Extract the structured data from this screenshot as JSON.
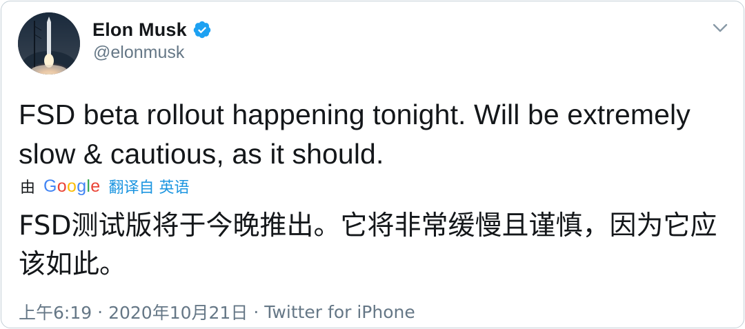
{
  "author": {
    "display_name": "Elon Musk",
    "handle": "@elonmusk",
    "verified": true
  },
  "tweet": {
    "text": "FSD beta rollout happening tonight. Will be extremely slow & cautious, as it should."
  },
  "translation": {
    "prefix": "由",
    "provider_letters": [
      "G",
      "o",
      "o",
      "g",
      "l",
      "e"
    ],
    "provider_colors": [
      "#4285f4",
      "#ea4335",
      "#fbbc05",
      "#4285f4",
      "#34a853",
      "#ea4335"
    ],
    "link_text": "翻译自 英语",
    "text": "FSD测试版将于今晚推出。它将非常缓慢且谨慎，因为它应该如此。"
  },
  "meta": {
    "time": "上午6:19",
    "separator": "·",
    "date": "2020年10月21日",
    "source": "Twitter for iPhone"
  },
  "colors": {
    "verified": "#1da1f2",
    "link": "#1b95e0",
    "secondary_text": "#657786",
    "border": "#c4cfd6"
  },
  "icons": {
    "avatar": "rocket-launch-avatar",
    "verified": "verified-badge-icon",
    "menu": "chevron-down-icon"
  }
}
